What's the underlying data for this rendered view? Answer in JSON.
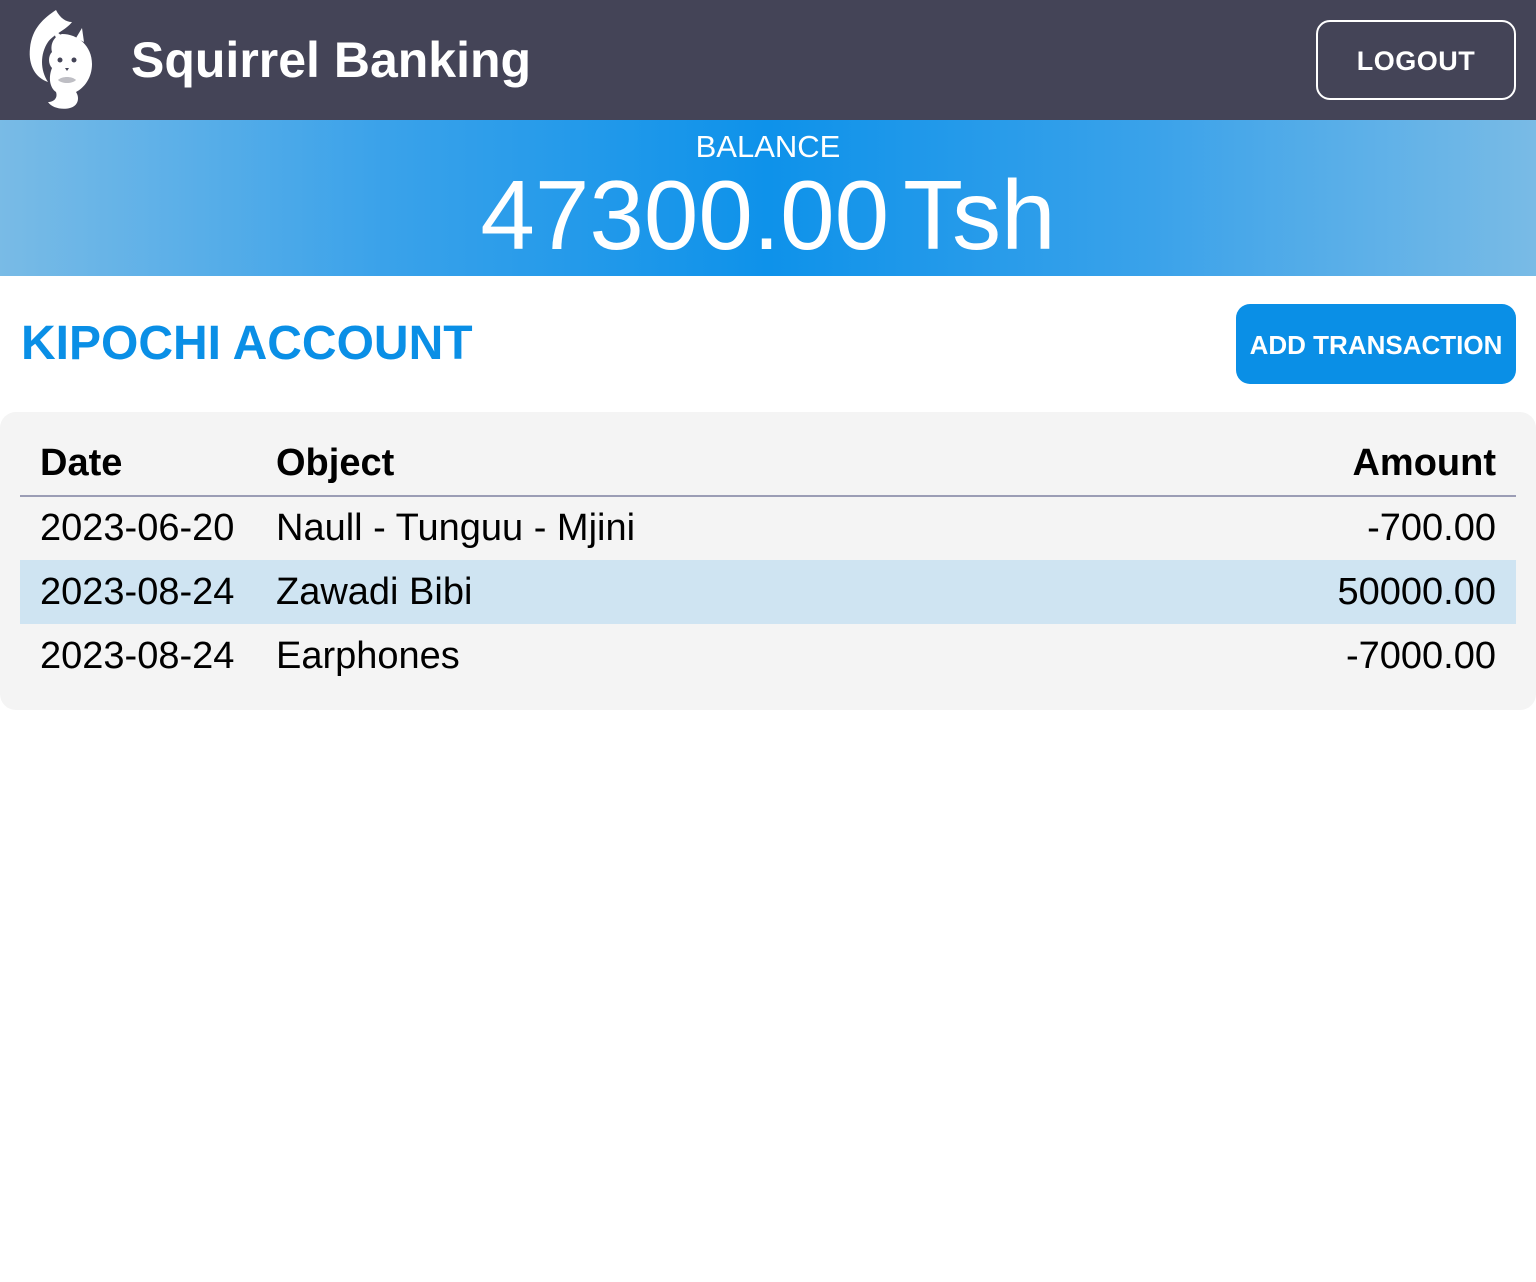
{
  "header": {
    "app_title": "Squirrel Banking",
    "logout_label": "LOGOUT",
    "logo_icon": "squirrel-logo-icon"
  },
  "balance": {
    "label": "BALANCE",
    "amount": "47300.00",
    "currency": "Tsh"
  },
  "account": {
    "title": "KIPOCHI ACCOUNT",
    "add_transaction_label": "ADD TRANSACTION"
  },
  "table": {
    "headers": {
      "date": "Date",
      "object": "Object",
      "amount": "Amount"
    },
    "rows": [
      {
        "date": "2023-06-20",
        "object": "Naull - Tunguu - Mjini",
        "amount": "-700.00",
        "highlighted": false
      },
      {
        "date": "2023-08-24",
        "object": "Zawadi Bibi",
        "amount": "50000.00",
        "highlighted": true
      },
      {
        "date": "2023-08-24",
        "object": "Earphones",
        "amount": "-7000.00",
        "highlighted": false
      }
    ]
  },
  "colors": {
    "header_bg": "#444457",
    "accent": "#0a8fe6",
    "row_highlight": "#cfe4f2",
    "card_bg": "#f4f4f4"
  }
}
